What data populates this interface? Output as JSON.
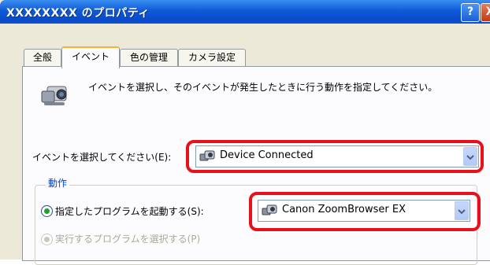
{
  "window": {
    "title": "XXXXXXXX のプロパティ",
    "help_glyph": "?",
    "close_glyph": "X"
  },
  "tabs": [
    {
      "label": "全般",
      "selected": false
    },
    {
      "label": "イベント",
      "selected": true
    },
    {
      "label": "色の管理",
      "selected": false
    },
    {
      "label": "カメラ設定",
      "selected": false
    }
  ],
  "event_tab": {
    "description": "イベントを選択し、そのイベントが発生したときに行う動作を指定してください。",
    "event_label": "イベントを選択してください(E):",
    "event_value": "Device Connected",
    "actions_group": "動作",
    "start_program_label": "指定したプログラムを起動する(S):",
    "program_value": "Canon ZoomBrowser EX",
    "prompt_program_label": "実行するプログラムを選択する(P)"
  },
  "colors": {
    "titlebar": "#0a4ac8",
    "highlight": "#e8101a",
    "group_legend": "#0046d5",
    "tab_accent": "#f7b038"
  }
}
